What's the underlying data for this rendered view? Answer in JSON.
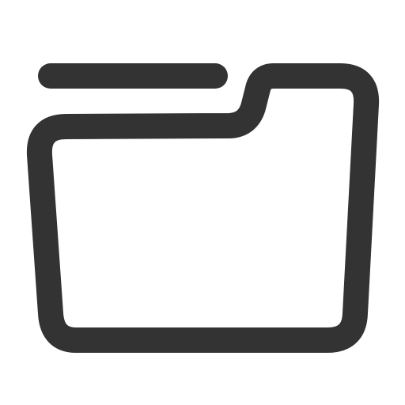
{
  "icon": {
    "name": "folder-icon",
    "stroke_color": "#333333",
    "background_color": "#ffffff"
  }
}
